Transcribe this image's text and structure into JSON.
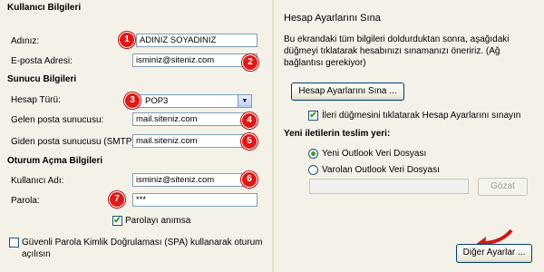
{
  "left": {
    "user_info_header": "Kullanıcı Bilgileri",
    "name_label": "Adınız:",
    "name_value": "ADINIZ SOYADINIZ",
    "email_label": "E-posta Adresi:",
    "email_value": "isminiz@siteniz.com",
    "server_info_header": "Sunucu Bilgileri",
    "account_type_label": "Hesap Türü:",
    "account_type_value": "POP3",
    "incoming_label": "Gelen posta sunucusu:",
    "incoming_value": "mail.siteniz.com",
    "outgoing_label": "Giden posta sunucusu (SMTP):",
    "outgoing_value": "mail.siteniz.com",
    "logon_header": "Oturum Açma Bilgileri",
    "username_label": "Kullanıcı Adı:",
    "username_value": "isminiz@siteniz.com",
    "password_label": "Parola:",
    "password_value": "***",
    "remember_password_label": "Parolayı anımsa",
    "remember_password_checked": true,
    "spa_label_line1": "Güvenli Parola Kimlik Doğrulaması (SPA) kullanarak oturum",
    "spa_label_line2": "açılısın",
    "spa_checked": false
  },
  "right": {
    "test_header": "Hesap Ayarlarını Sına",
    "test_desc_line1": "Bu ekrandaki tüm bilgileri doldurduktan sonra, aşağıdaki",
    "test_desc_line2": "düğmeyi tıklatarak hesabınızı sınamanızı öneririz. (Ağ",
    "test_desc_line3": "bağlantısı gerekiyor)",
    "test_button_label": "Hesap Ayarlarını Sına ...",
    "next_test_label": "İleri düğmesini tıklatarak Hesap Ayarlarını sınayın",
    "next_test_checked": true,
    "deliver_header": "Yeni iletilerin teslim yeri:",
    "new_data_file_label": "Yeni Outlook Veri Dosyası",
    "existing_data_file_label": "Varolan Outlook Veri Dosyası",
    "selected_option": "new",
    "browse_button_label": "Gözat",
    "more_settings_label": "Diğer Ayarlar ..."
  },
  "badges": [
    "1",
    "2",
    "3",
    "4",
    "5",
    "6",
    "7"
  ],
  "colors": {
    "badge": "#e01818",
    "window_bg": "#f4f1e8",
    "check": "#21a121"
  }
}
